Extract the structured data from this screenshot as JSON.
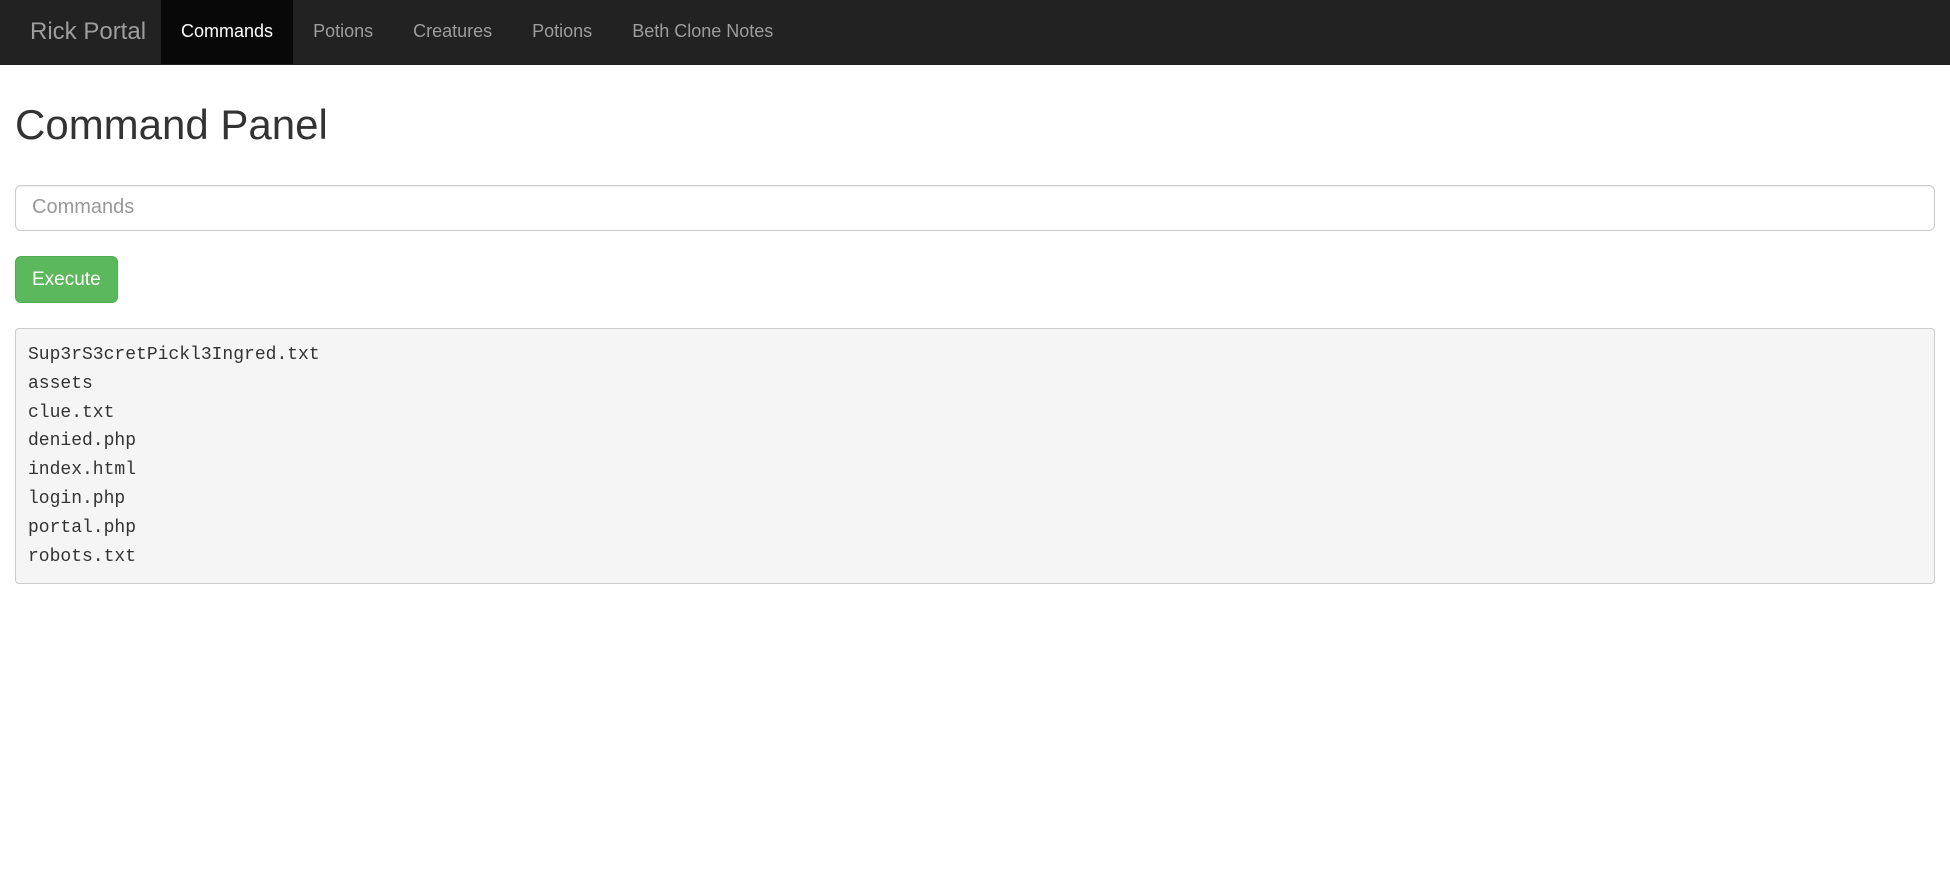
{
  "navbar": {
    "brand": "Rick Portal",
    "items": [
      {
        "label": "Commands",
        "active": true
      },
      {
        "label": "Potions",
        "active": false
      },
      {
        "label": "Creatures",
        "active": false
      },
      {
        "label": "Potions",
        "active": false
      },
      {
        "label": "Beth Clone Notes",
        "active": false
      }
    ]
  },
  "main": {
    "title": "Command Panel",
    "command_placeholder": "Commands",
    "command_value": "",
    "execute_label": "Execute",
    "output": "Sup3rS3cretPickl3Ingred.txt\nassets\nclue.txt\ndenied.php\nindex.html\nlogin.php\nportal.php\nrobots.txt"
  }
}
